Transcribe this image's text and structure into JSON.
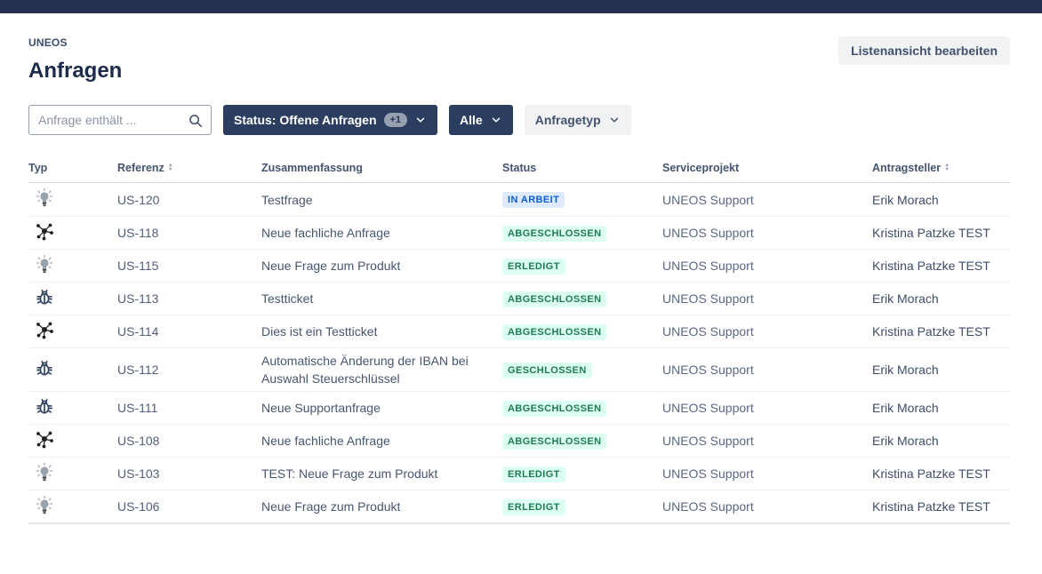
{
  "header": {
    "breadcrumb": "UNEOS",
    "title": "Anfragen",
    "edit_button_label": "Listenansicht bearbeiten"
  },
  "filters": {
    "search_placeholder": "Anfrage enthält ...",
    "status": {
      "label": "Status: Offene Anfragen",
      "extra_count": "+1"
    },
    "alle_label": "Alle",
    "anfragetyp_label": "Anfragetyp"
  },
  "table": {
    "columns": [
      {
        "label": "Typ",
        "sortable": false
      },
      {
        "label": "Referenz",
        "sortable": true
      },
      {
        "label": "Zusammenfassung",
        "sortable": false
      },
      {
        "label": "Status",
        "sortable": false
      },
      {
        "label": "Serviceprojekt",
        "sortable": false
      },
      {
        "label": "Antragsteller",
        "sortable": true
      }
    ],
    "rows": [
      {
        "type": "question",
        "type_icon": "lightbulb-icon",
        "reference": "US-120",
        "summary": "Testfrage",
        "status": "IN ARBEIT",
        "status_color": "blue",
        "serviceproject": "UNEOS Support",
        "requester": "Erik Morach"
      },
      {
        "type": "network",
        "type_icon": "network-icon",
        "reference": "US-118",
        "summary": "Neue fachliche Anfrage",
        "status": "ABGESCHLOSSEN",
        "status_color": "green",
        "serviceproject": "UNEOS Support",
        "requester": "Kristina Patzke TEST"
      },
      {
        "type": "question",
        "type_icon": "lightbulb-icon",
        "reference": "US-115",
        "summary": "Neue Frage zum Produkt",
        "status": "ERLEDIGT",
        "status_color": "green",
        "serviceproject": "UNEOS Support",
        "requester": "Kristina Patzke TEST"
      },
      {
        "type": "bug",
        "type_icon": "bug-icon",
        "reference": "US-113",
        "summary": "Testticket",
        "status": "ABGESCHLOSSEN",
        "status_color": "green",
        "serviceproject": "UNEOS Support",
        "requester": "Erik Morach"
      },
      {
        "type": "network",
        "type_icon": "network-icon",
        "reference": "US-114",
        "summary": "Dies ist ein Testticket",
        "status": "ABGESCHLOSSEN",
        "status_color": "green",
        "serviceproject": "UNEOS Support",
        "requester": "Kristina Patzke TEST"
      },
      {
        "type": "bug",
        "type_icon": "bug-icon",
        "reference": "US-112",
        "summary": "Automatische Änderung der IBAN bei Auswahl Steuerschlüssel",
        "status": "GESCHLOSSEN",
        "status_color": "green",
        "serviceproject": "UNEOS Support",
        "requester": "Erik Morach"
      },
      {
        "type": "bug",
        "type_icon": "bug-icon",
        "reference": "US-111",
        "summary": "Neue Supportanfrage",
        "status": "ABGESCHLOSSEN",
        "status_color": "green",
        "serviceproject": "UNEOS Support",
        "requester": "Erik Morach"
      },
      {
        "type": "network",
        "type_icon": "network-icon",
        "reference": "US-108",
        "summary": "Neue fachliche Anfrage",
        "status": "ABGESCHLOSSEN",
        "status_color": "green",
        "serviceproject": "UNEOS Support",
        "requester": "Erik Morach"
      },
      {
        "type": "question",
        "type_icon": "lightbulb-icon",
        "reference": "US-103",
        "summary": "TEST: Neue Frage zum Produkt",
        "status": "ERLEDIGT",
        "status_color": "green",
        "serviceproject": "UNEOS Support",
        "requester": "Kristina Patzke TEST"
      },
      {
        "type": "question",
        "type_icon": "lightbulb-icon",
        "reference": "US-106",
        "summary": "Neue Frage zum Produkt",
        "status": "ERLEDIGT",
        "status_color": "green",
        "serviceproject": "UNEOS Support",
        "requester": "Kristina Patzke TEST"
      }
    ]
  },
  "colors": {
    "topbar": "#25314f",
    "filter_chip": "#2c3e5f",
    "badge_in_progress_bg": "#deebff",
    "badge_in_progress_text": "#0b5cd7",
    "badge_done_bg": "#dcfff1",
    "badge_done_text": "#1f7a55"
  }
}
